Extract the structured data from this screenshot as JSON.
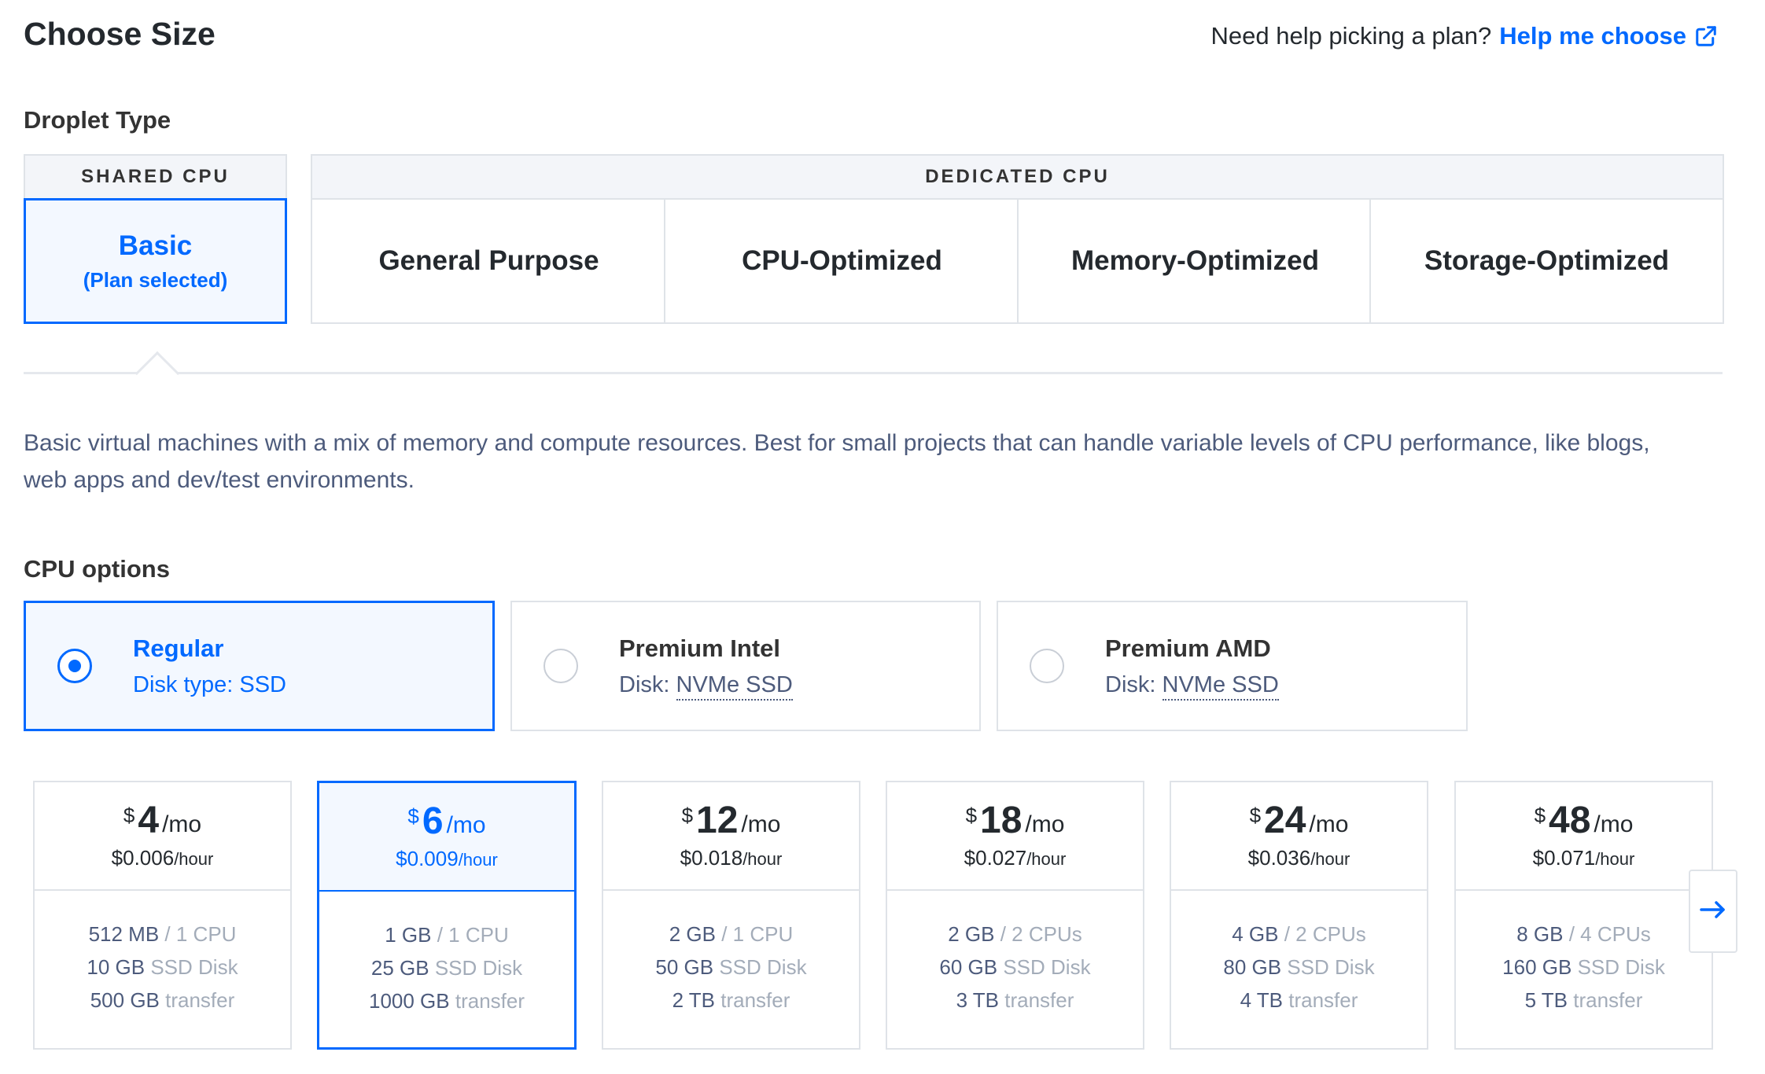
{
  "header": {
    "title": "Choose Size",
    "help_text": "Need help picking a plan?",
    "help_link": "Help me choose"
  },
  "droplet_type": {
    "label": "Droplet Type",
    "shared_header": "SHARED CPU",
    "dedicated_header": "DEDICATED CPU",
    "basic": {
      "label": "Basic",
      "sub": "(Plan selected)"
    },
    "dedicated": [
      {
        "label": "General Purpose"
      },
      {
        "label": "CPU-Optimized"
      },
      {
        "label": "Memory-Optimized"
      },
      {
        "label": "Storage-Optimized"
      }
    ]
  },
  "description": "Basic virtual machines with a mix of memory and compute resources. Best for small projects that can handle variable levels of CPU performance, like blogs, web apps and dev/test environments.",
  "cpu_options": {
    "label": "CPU options",
    "items": [
      {
        "title": "Regular",
        "sub": "Disk type: SSD",
        "selected": true
      },
      {
        "title": "Premium Intel",
        "sub_prefix": "Disk:",
        "sub_value": "NVMe SSD",
        "selected": false
      },
      {
        "title": "Premium AMD",
        "sub_prefix": "Disk:",
        "sub_value": "NVMe SSD",
        "selected": false
      }
    ]
  },
  "plans": [
    {
      "currency": "$",
      "amount": "4",
      "per": "/mo",
      "hourly": "$0.006",
      "hourly_unit": "/hour",
      "mem": "512 MB",
      "cpu": "/ 1 CPU",
      "disk": "10 GB",
      "disk_label": "SSD Disk",
      "transfer": "500 GB",
      "transfer_label": "transfer"
    },
    {
      "currency": "$",
      "amount": "6",
      "per": "/mo",
      "hourly": "$0.009",
      "hourly_unit": "/hour",
      "mem": "1 GB",
      "cpu": "/ 1 CPU",
      "disk": "25 GB",
      "disk_label": "SSD Disk",
      "transfer": "1000 GB",
      "transfer_label": "transfer"
    },
    {
      "currency": "$",
      "amount": "12",
      "per": "/mo",
      "hourly": "$0.018",
      "hourly_unit": "/hour",
      "mem": "2 GB",
      "cpu": "/ 1 CPU",
      "disk": "50 GB",
      "disk_label": "SSD Disk",
      "transfer": "2 TB",
      "transfer_label": "transfer"
    },
    {
      "currency": "$",
      "amount": "18",
      "per": "/mo",
      "hourly": "$0.027",
      "hourly_unit": "/hour",
      "mem": "2 GB",
      "cpu": "/ 2 CPUs",
      "disk": "60 GB",
      "disk_label": "SSD Disk",
      "transfer": "3 TB",
      "transfer_label": "transfer"
    },
    {
      "currency": "$",
      "amount": "24",
      "per": "/mo",
      "hourly": "$0.036",
      "hourly_unit": "/hour",
      "mem": "4 GB",
      "cpu": "/ 2 CPUs",
      "disk": "80 GB",
      "disk_label": "SSD Disk",
      "transfer": "4 TB",
      "transfer_label": "transfer"
    },
    {
      "currency": "$",
      "amount": "48",
      "per": "/mo",
      "hourly": "$0.071",
      "hourly_unit": "/hour",
      "mem": "8 GB",
      "cpu": "/ 4 CPUs",
      "disk": "160 GB",
      "disk_label": "SSD Disk",
      "transfer": "5 TB",
      "transfer_label": "transfer"
    }
  ],
  "selected_plan_index": 1,
  "colors": {
    "accent": "#0069ff",
    "border": "#dfe3e8",
    "selected_bg": "#f3f8ff"
  },
  "icons": {
    "external": "external-link-icon",
    "next": "arrow-right-icon"
  }
}
